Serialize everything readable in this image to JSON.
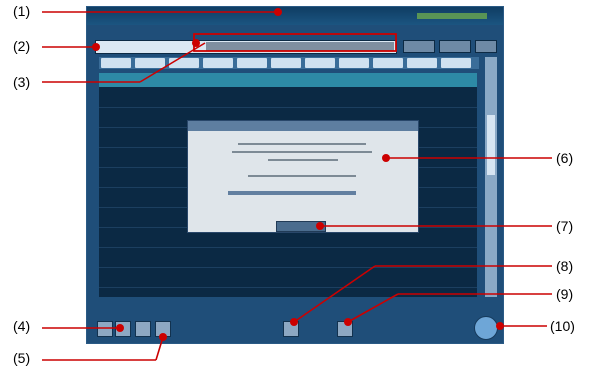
{
  "callouts": [
    "(1)",
    "(2)",
    "(3)",
    "(4)",
    "(5)",
    "(6)",
    "(7)",
    "(8)",
    "(9)",
    "(10)"
  ],
  "colors": {
    "screen_bg": "#1f4e79",
    "header_teal": "#2d8aa6",
    "grid_dark": "#0b2944",
    "dialog_bg": "#dfe5ea",
    "button_blue": "#6ea6d7"
  }
}
